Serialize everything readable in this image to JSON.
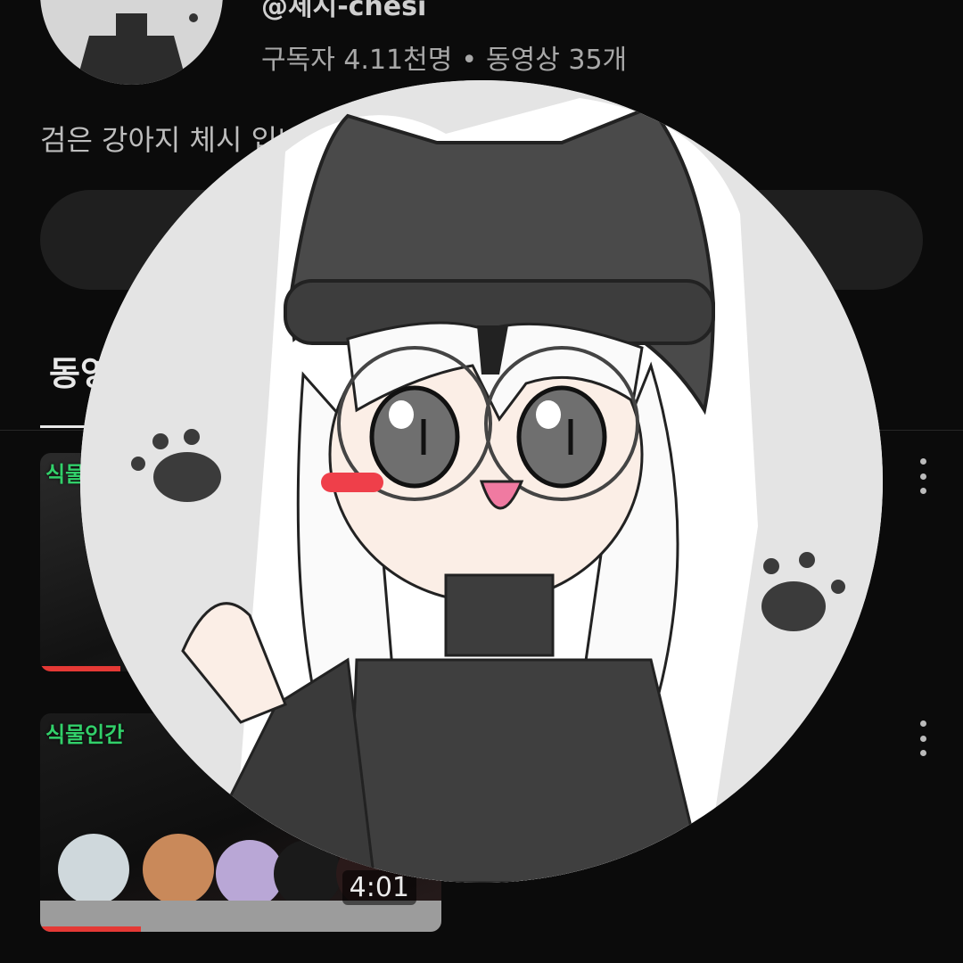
{
  "channel": {
    "handle": "@체시-chesi",
    "subscribers": "구독자 4.11천명",
    "separator": "•",
    "videos": "동영상 35개",
    "description": "검은 강아지 체시 입니"
  },
  "tabs": [
    {
      "label": "동영"
    }
  ],
  "videos": [
    {
      "title_overlay": "식물인",
      "duration": "",
      "progress": 0.2
    },
    {
      "title_overlay": "식물인간",
      "duration": "4:01",
      "progress": 0.25
    }
  ],
  "colors": {
    "background": "#0b0b0b",
    "progress": "#e53935",
    "pill": "#1f1f1f"
  }
}
